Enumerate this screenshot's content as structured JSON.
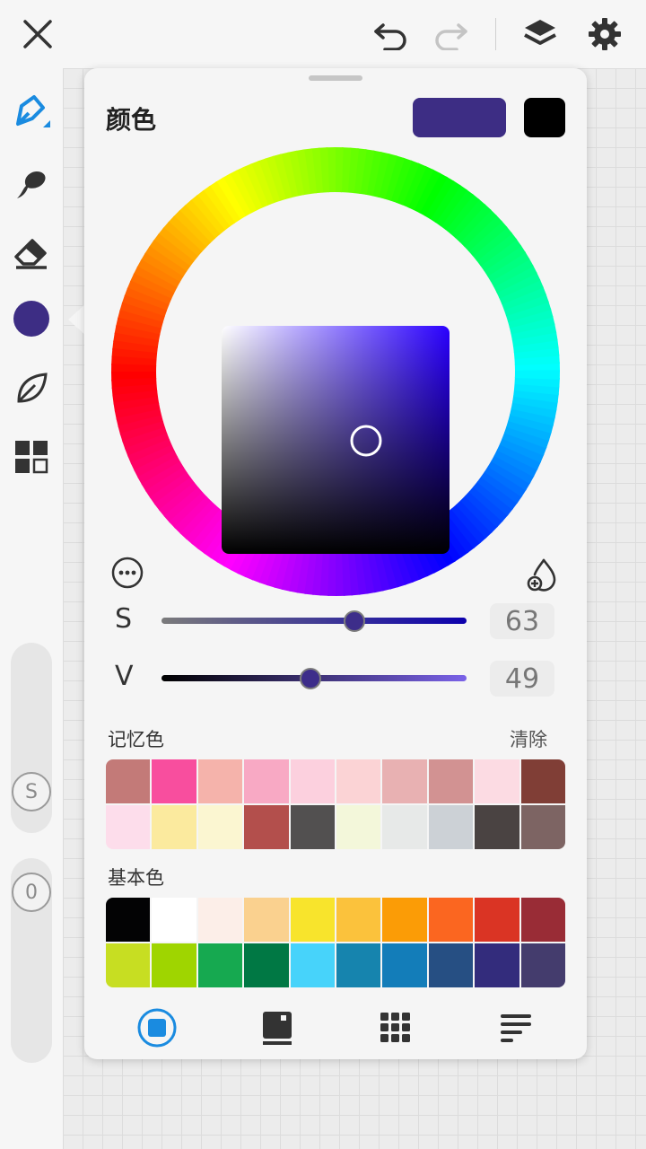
{
  "panel": {
    "title": "颜色",
    "current_color": "#3D2D84",
    "secondary_color": "#000000",
    "saturation": {
      "label": "S",
      "value": "63"
    },
    "value": {
      "label": "V",
      "value": "49"
    }
  },
  "memory_colors": {
    "title": "记忆色",
    "clear_label": "清除",
    "colors": [
      "#C37A78",
      "#F84E9E",
      "#F5B3AB",
      "#F8A9C4",
      "#FCD0DE",
      "#FBD3D5",
      "#E8B1B2",
      "#D29292",
      "#FCDBE3",
      "#803E36",
      "#FDDDEB",
      "#FBEA9E",
      "#FBF6D1",
      "#B34F4C",
      "#525050",
      "#F3F7DA",
      "#E7E9E8",
      "#CCD1D6",
      "#4A4342",
      "#7D6463"
    ]
  },
  "basic_colors": {
    "title": "基本色",
    "colors": [
      "#030304",
      "#FFFFFF",
      "#FCEEE8",
      "#FAD18F",
      "#F8E42C",
      "#FBC23C",
      "#FB9C06",
      "#FB6620",
      "#DA3424",
      "#992C36",
      "#C7DE22",
      "#9FD500",
      "#16A950",
      "#007844",
      "#47D3FA",
      "#1684AE",
      "#137DB9",
      "#264F83",
      "#332C7C",
      "#443C6D"
    ]
  },
  "icons": {
    "close": "close-icon",
    "undo": "undo-icon",
    "redo": "redo-icon",
    "layers": "layers-icon",
    "settings": "gear-icon"
  }
}
